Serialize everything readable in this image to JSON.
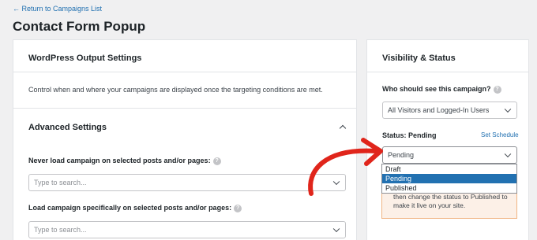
{
  "header": {
    "back_link": "← Return to Campaigns List",
    "title": "Contact Form Popup"
  },
  "left": {
    "wp_output_title": "WordPress Output Settings",
    "wp_output_desc": "Control when and where your campaigns are displayed once the targeting conditions are met.",
    "advanced_title": "Advanced Settings",
    "never_load_label": "Never load campaign on selected posts and/or pages:",
    "never_load_placeholder": "Type to search...",
    "load_specific_label": "Load campaign specifically on selected posts and/or pages:",
    "load_specific_placeholder": "Type to search..."
  },
  "right": {
    "title": "Visibility & Status",
    "who_label": "Who should see this campaign?",
    "who_value": "All Visitors and Logged-In Users",
    "status_label": "Status: Pending",
    "schedule_link": "Set Schedule",
    "status_value": "Pending",
    "status_options": [
      "Draft",
      "Pending",
      "Published"
    ],
    "status_selected_index": 1,
    "notice_line1": "then change the status to Published to",
    "notice_line2": "make it live on your site."
  },
  "colors": {
    "accent": "#2271b1",
    "arrow": "#e0251b",
    "notice_bg": "#fcf0e7",
    "notice_border": "#f0b584"
  }
}
